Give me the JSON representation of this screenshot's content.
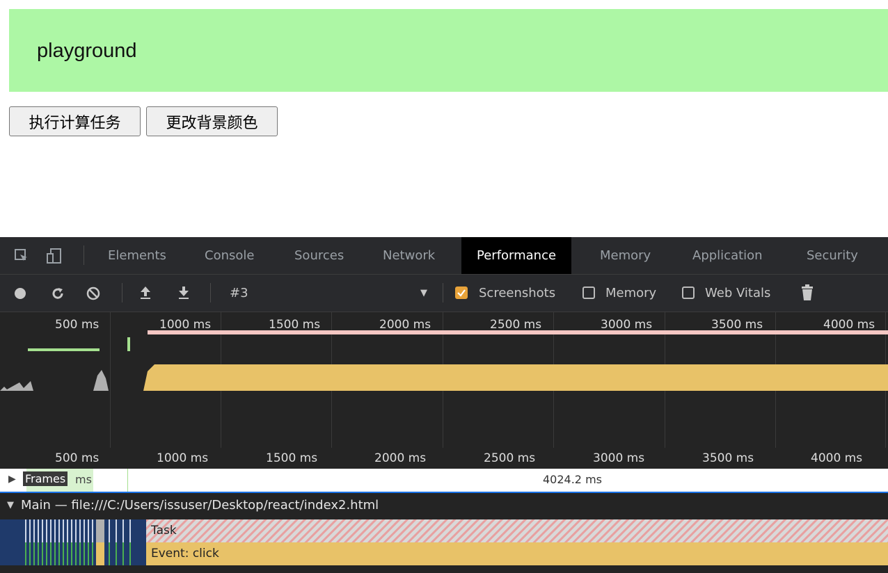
{
  "page": {
    "playground_text": "playground",
    "buttons": [
      "执行计算任务",
      "更改背景颜色"
    ]
  },
  "devtools": {
    "tabs": [
      "Elements",
      "Console",
      "Sources",
      "Network",
      "Performance",
      "Memory",
      "Application",
      "Security"
    ],
    "active_tab": "Performance",
    "toolbar": {
      "recording_name": "#3",
      "screenshots_label": "Screenshots",
      "memory_label": "Memory",
      "web_vitals_label": "Web Vitals",
      "screenshots_checked": true,
      "memory_checked": false,
      "web_vitals_checked": false
    },
    "overview_ruler": [
      "500 ms",
      "1000 ms",
      "1500 ms",
      "2000 ms",
      "2500 ms",
      "3000 ms",
      "3500 ms",
      "4000 ms"
    ],
    "timeline_ruler": [
      "500 ms",
      "1000 ms",
      "1500 ms",
      "2000 ms",
      "2500 ms",
      "3000 ms",
      "3500 ms",
      "4000 ms"
    ],
    "frames": {
      "label": "Frames",
      "short_label": "ms",
      "duration": "4024.2 ms"
    },
    "main_thread": {
      "title": "Main — file:///C:/Users/issuser/Desktop/react/index2.html",
      "task_label": "Task",
      "event_label": "Event: click"
    }
  }
}
